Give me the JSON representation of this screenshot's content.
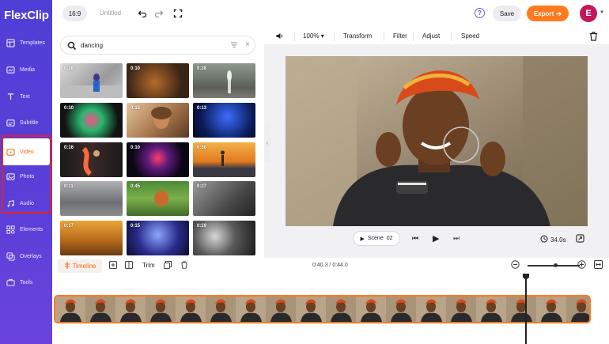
{
  "app": {
    "logo_text": "FlexClip"
  },
  "sidebar": {
    "items": [
      {
        "label": "Templates",
        "icon": "template-icon"
      },
      {
        "label": "Media",
        "icon": "media-icon"
      },
      {
        "label": "Text",
        "icon": "text-icon"
      },
      {
        "label": "Subtitle",
        "icon": "subtitle-icon"
      },
      {
        "label": "Video",
        "icon": "video-icon",
        "active": true
      },
      {
        "label": "Photo",
        "icon": "photo-icon"
      },
      {
        "label": "Audio",
        "icon": "audio-icon"
      },
      {
        "label": "Elements",
        "icon": "elements-icon"
      },
      {
        "label": "Overlays",
        "icon": "overlays-icon"
      },
      {
        "label": "Tools",
        "icon": "tools-icon"
      }
    ]
  },
  "header": {
    "ratio": "16:9",
    "title": "Untitled",
    "save_label": "Save",
    "export_label": "Export",
    "avatar_letter": "E",
    "help_glyph": "?"
  },
  "search": {
    "value": "dancing"
  },
  "media": {
    "durations": [
      "0:28",
      "0:10",
      "0:28",
      "0:10",
      "0:15",
      "0:13",
      "0:16",
      "0:10",
      "0:50",
      "0:11",
      "0:45",
      "0:27",
      "0:17",
      "0:15",
      "0:19"
    ]
  },
  "editor_toolbar": {
    "zoom": "100%",
    "items": [
      "Transform",
      "Filter",
      "Adjust",
      "Speed"
    ]
  },
  "playback": {
    "scene_label": "Scene",
    "scene_number": "02",
    "duration": "34.0s"
  },
  "timeline": {
    "tab_label": "Timeline",
    "trim_label": "Trim",
    "current_time": "0:40.3",
    "total_time": "0:44.0",
    "time_separator": "/"
  },
  "colors": {
    "sidebar": "#5340d8",
    "accent": "#ff7a1f",
    "highlight": "#e5202a",
    "avatar": "#c2185b"
  }
}
